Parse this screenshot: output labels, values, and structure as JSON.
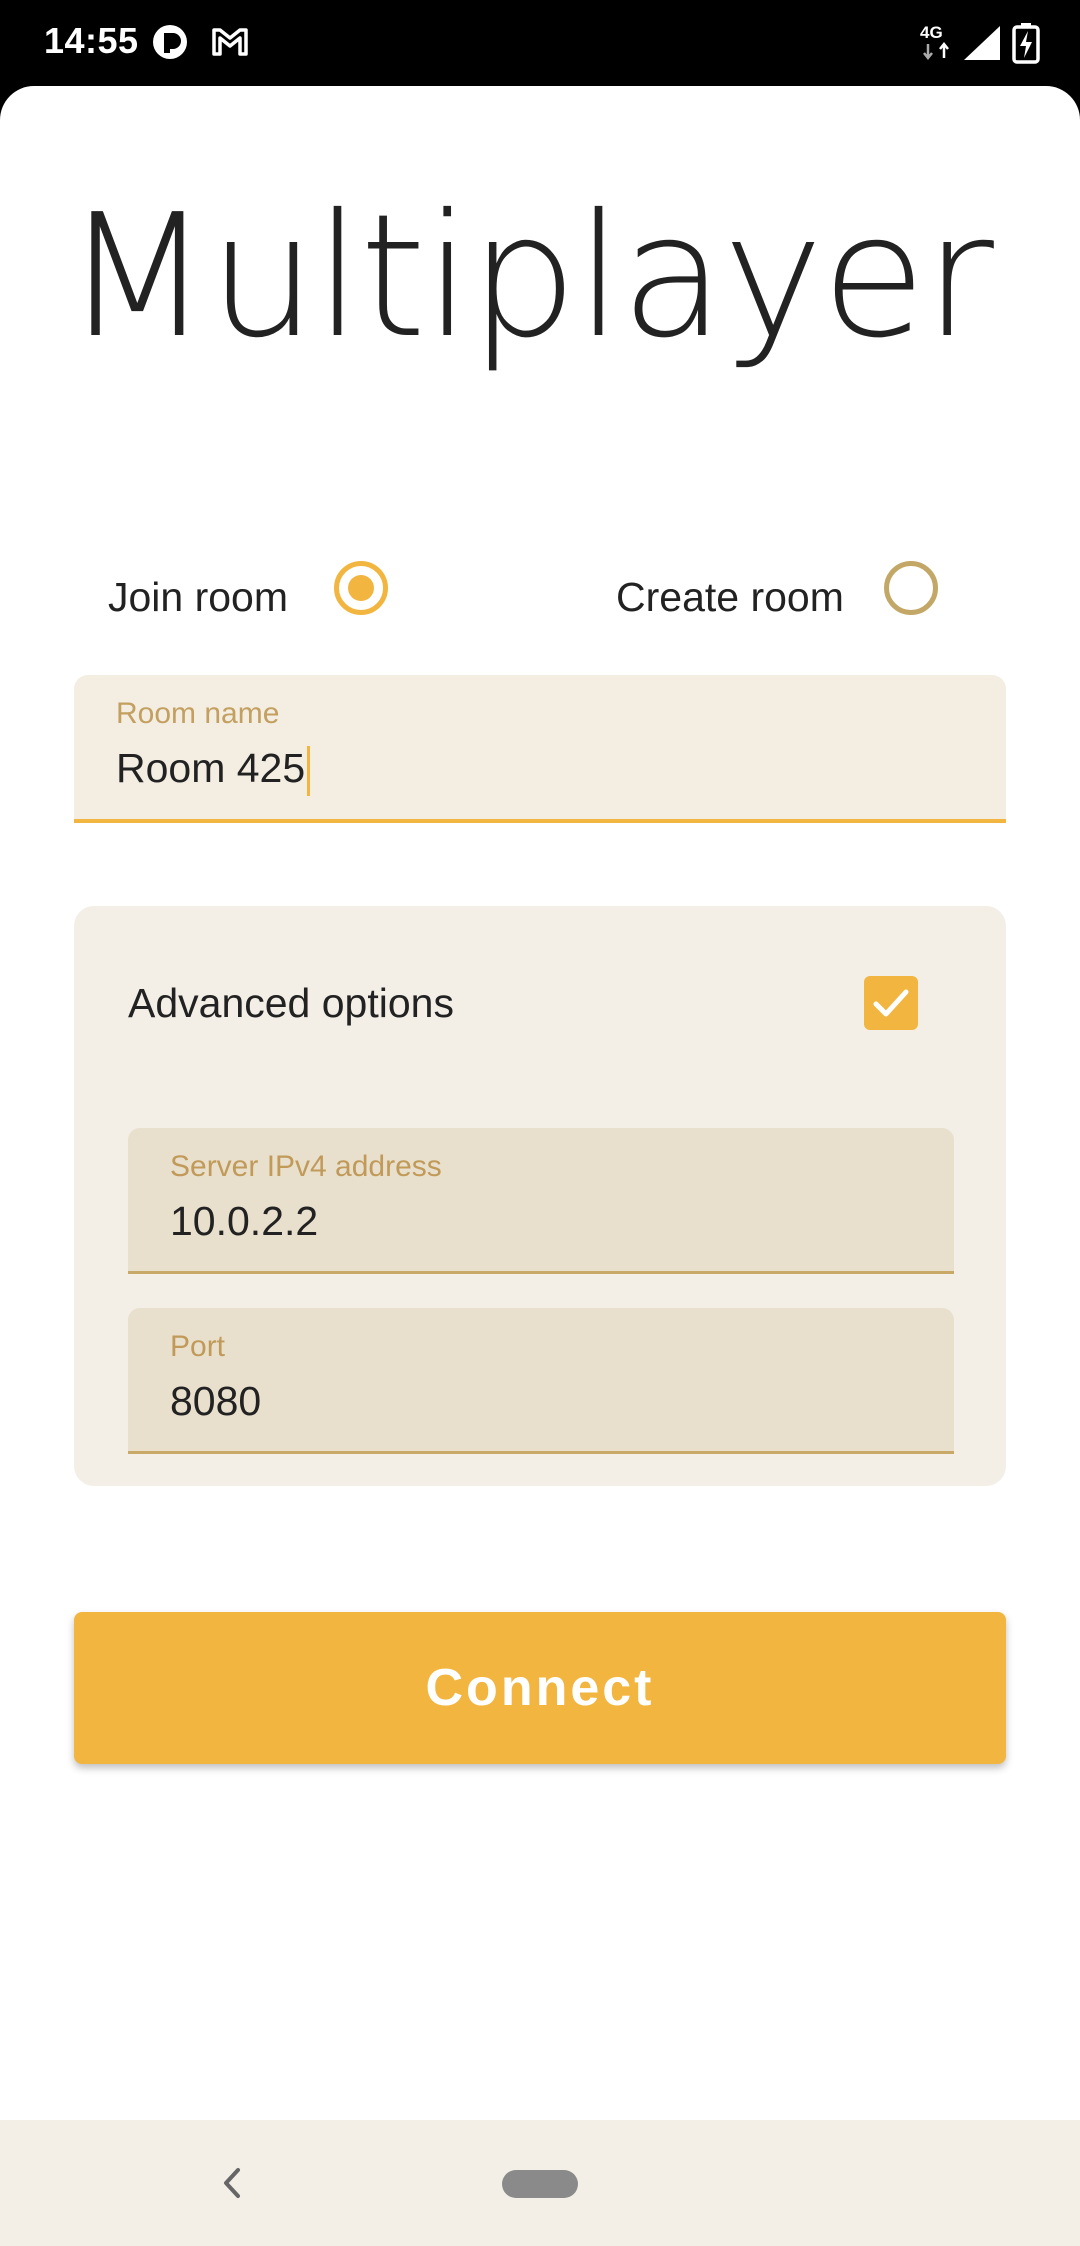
{
  "status_bar": {
    "time": "14:55",
    "network": "4G",
    "icons": [
      "app-notification-icon",
      "gmail-icon",
      "network-4g-icon",
      "signal-icon",
      "battery-charging-icon"
    ]
  },
  "page": {
    "title": "Multiplayer"
  },
  "mode": {
    "join_label": "Join room",
    "join_selected": true,
    "create_label": "Create room",
    "create_selected": false
  },
  "room_name_field": {
    "label": "Room name",
    "value": "Room 425"
  },
  "advanced": {
    "label": "Advanced options",
    "checked": true,
    "server_field": {
      "label": "Server IPv4 address",
      "value": "10.0.2.2"
    },
    "port_field": {
      "label": "Port",
      "value": "8080"
    }
  },
  "connect_button": {
    "label": "Connect"
  },
  "colors": {
    "accent": "#f2b640",
    "field_bg": "#f3ede2",
    "card_bg": "#f3efe7",
    "inner_field_bg": "#e8e0cd",
    "label_color": "#c3a060"
  },
  "nav_bar": {
    "icons": [
      "back-icon",
      "home-pill-icon"
    ]
  }
}
